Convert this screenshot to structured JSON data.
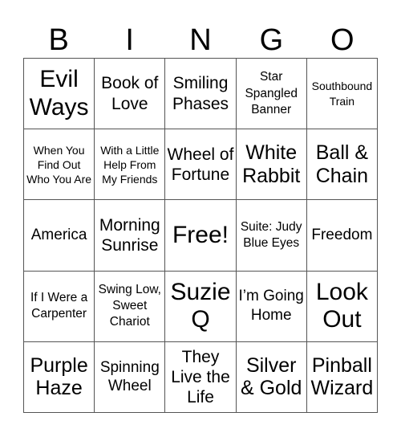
{
  "header": [
    "B",
    "I",
    "N",
    "G",
    "O"
  ],
  "cells": [
    [
      "Evil Ways",
      "Book of Love",
      "Smiling Phases",
      "Star Spangled Banner",
      "Southbound Train"
    ],
    [
      "When You Find Out Who You Are",
      "With a Little Help From My Friends",
      "Wheel of Fortune",
      "White Rabbit",
      "Ball & Chain"
    ],
    [
      "America",
      "Morning Sunrise",
      "Free!",
      "Suite: Judy Blue Eyes",
      "Freedom"
    ],
    [
      "If I Were a Carpenter",
      "Swing Low, Sweet Chariot",
      "Suzie Q",
      "I’m Going Home",
      "Look Out"
    ],
    [
      "Purple Haze",
      "Spinning Wheel",
      "They Live the Life",
      "Silver & Gold",
      "Pinball Wizard"
    ]
  ]
}
